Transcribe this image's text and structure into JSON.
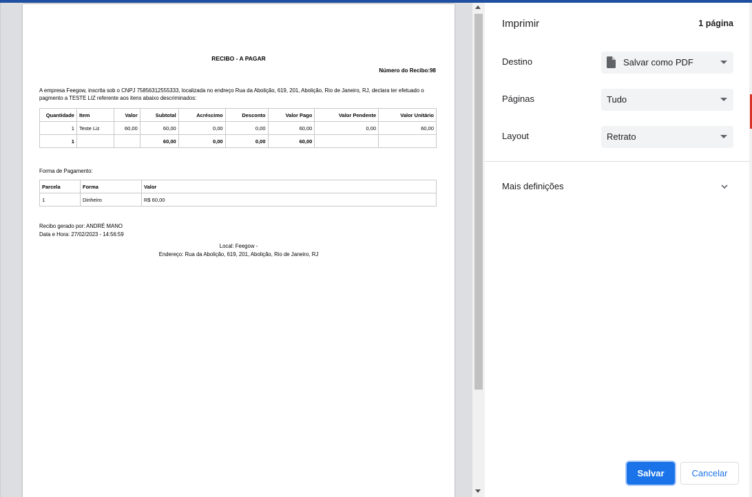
{
  "preview": {
    "document": {
      "title": "RECIBO - A PAGAR",
      "receipt_number": "Número do Recibo:98",
      "declaration": "A empresa Feegow, inscrita sob o CNPJ 75856312555333, localizada no endreço Rua da Abolição, 619, 201, Abolição, Rio de Janeiro, RJ, declara ter efetuado o pagmento a  TESTE LIZ referente aos itens abaixo descriminados:",
      "items_table": {
        "headers": [
          "Quantidade",
          "Item",
          "Valor",
          "Subtotal",
          "Acréscimo",
          "Desconto",
          "Valor Pago",
          "Valor Pendente",
          "Valor Unitário"
        ],
        "rows": [
          [
            "1",
            "Teste Liz",
            "60,00",
            "60,00",
            "0,00",
            "0,00",
            "60,00",
            "0,00",
            "60,00"
          ]
        ],
        "totals": [
          "1",
          "",
          "",
          "60,00",
          "0,00",
          "0,00",
          "60,00",
          "",
          ""
        ]
      },
      "payment_label": "Forma de Pagamento:",
      "payments_table": {
        "headers": [
          "Parcela",
          "Forma",
          "Valor"
        ],
        "rows": [
          [
            "1",
            "Dinheiro",
            "R$ 60,00"
          ]
        ]
      },
      "generated_by": "Recibo gerado por: ANDRÉ MANO",
      "datetime": "Data e Hora: 27/02/2023 - 14:56:59",
      "local": "Local: Feegow -",
      "address": "Endereço: Rua da Abolição, 619, 201, Abolição, Rio de Janeiro, RJ"
    }
  },
  "panel": {
    "title": "Imprimir",
    "page_count": "1 página",
    "destination": {
      "label": "Destino",
      "value": "Salvar como PDF",
      "icon": "file-icon"
    },
    "pages": {
      "label": "Páginas",
      "value": "Tudo"
    },
    "layout": {
      "label": "Layout",
      "value": "Retrato"
    },
    "more_settings": "Mais definições",
    "save_label": "Salvar",
    "cancel_label": "Cancelar"
  },
  "colors": {
    "accent": "#1a73e8",
    "select_bg": "#f1f3f4",
    "preview_bg": "#dcdee2"
  }
}
